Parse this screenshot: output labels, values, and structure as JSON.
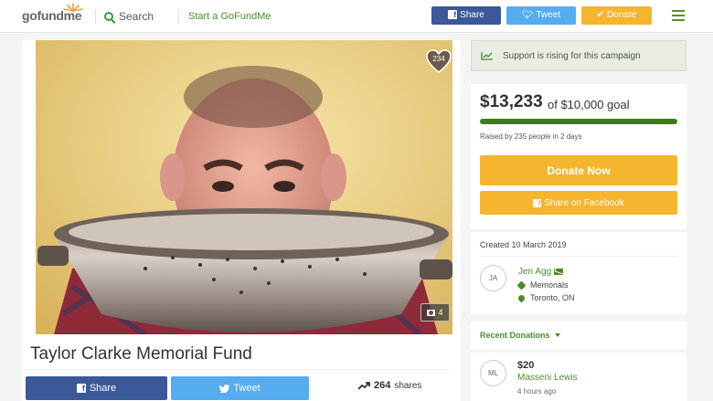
{
  "header": {
    "logo_go": "go",
    "logo_fund": "fund",
    "logo_me": "me",
    "search_label": "Search",
    "start_label": "Start a GoFundMe",
    "share_label": "Share",
    "tweet_label": "Tweet",
    "donate_label": "Donate"
  },
  "campaign": {
    "title": "Taylor Clarke Memorial Fund",
    "heart_count": "234",
    "photo_count": "4",
    "share_label": "Share",
    "tweet_label": "Tweet",
    "shares_count": "264",
    "shares_label": "shares"
  },
  "sidebar": {
    "rising_text": "Support is rising for this campaign",
    "raised_amount": "$13,233",
    "goal_text": "of $10,000 goal",
    "progress_fraction": 1.0,
    "raised_by": "Raised by 235 people in 2 days",
    "donate_now_label": "Donate Now",
    "share_facebook_label": "Share on Facebook",
    "created": "Created 10 March 2019",
    "organizer": {
      "initials": "JA",
      "name": "Jen Agg",
      "category": "Memorials",
      "location": "Toronto, ON"
    },
    "recent_donations_label": "Recent Donations",
    "donations": [
      {
        "initials": "ML",
        "amount": "$20",
        "name": "Masseni Lewis",
        "time": "4 hours ago"
      }
    ]
  },
  "colors": {
    "brand_green": "#4a8b2c",
    "facebook": "#3b5998",
    "twitter": "#55acee",
    "donate": "#f5b52e",
    "progress": "#3c7d1a"
  }
}
